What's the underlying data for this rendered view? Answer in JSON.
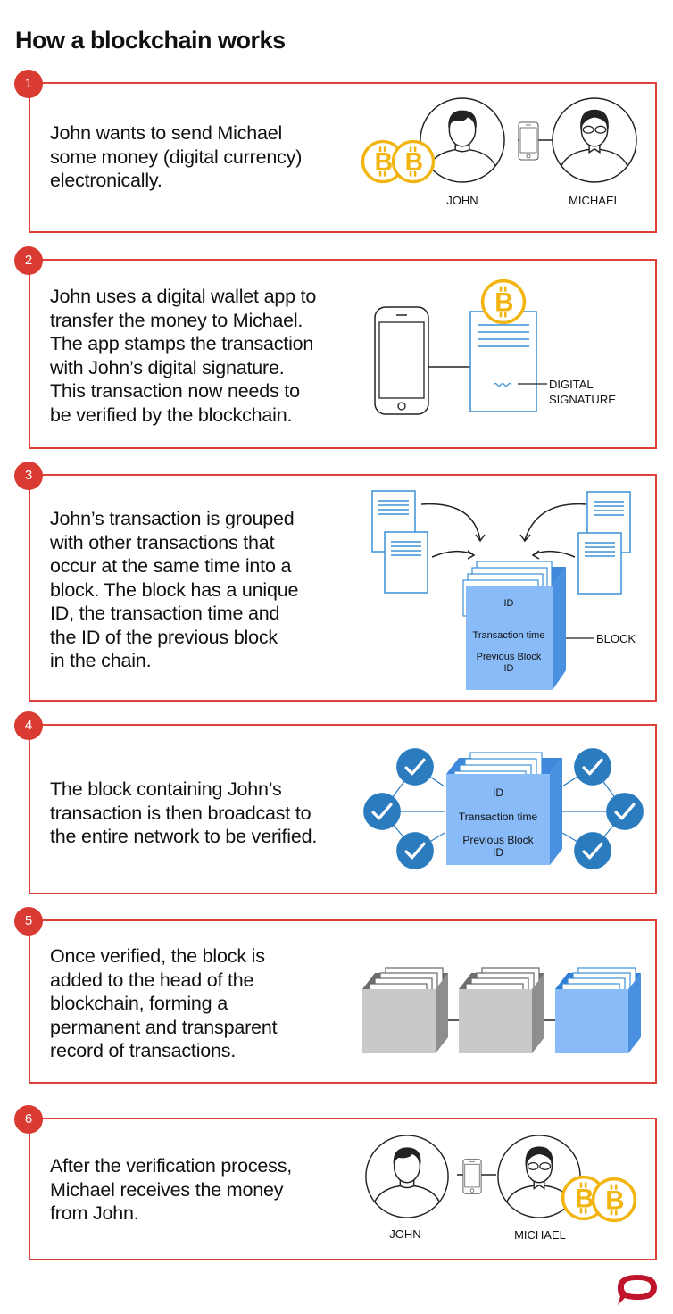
{
  "title": "How a blockchain works",
  "colors": {
    "accent_red": "#e0403a",
    "badge_red": "#d93a31",
    "coin_gold": "#f2b40f",
    "block_blue": "#88bbf7",
    "block_blue_dark": "#4a90e0",
    "node_blue": "#2b7bbf",
    "doc_blue": "#3b8fd6",
    "block_grey": "#c9c9c9",
    "logo_red": "#c0142a"
  },
  "steps": [
    {
      "number": "1",
      "lines": [
        "John wants to send Michael",
        "some money (digital currency)",
        "electronically."
      ],
      "labels": {
        "sender": "JOHN",
        "receiver": "MICHAEL"
      }
    },
    {
      "number": "2",
      "lines": [
        "John uses a digital wallet app to",
        "transfer the money to Michael.",
        "The app stamps the transaction",
        "with John’s digital signature.",
        "This transaction now needs to",
        "be verified by the blockchain."
      ],
      "labels": {
        "signature_line1": "DIGITAL",
        "signature_line2": "SIGNATURE"
      }
    },
    {
      "number": "3",
      "lines": [
        "John’s transaction is grouped",
        "with other transactions that",
        "occur at the same time into a",
        "block. The block has a unique",
        "ID, the transaction time and",
        "the ID of the previous block",
        "in the chain."
      ],
      "labels": {
        "block_id": "ID",
        "block_time": "Transaction time",
        "block_prev_1": "Previous Block",
        "block_prev_2": "ID",
        "block_callout": "BLOCK"
      }
    },
    {
      "number": "4",
      "lines": [
        "The block containing John’s",
        "transaction is then broadcast to",
        "the entire network to be verified."
      ],
      "labels": {
        "block_id": "ID",
        "block_time": "Transaction time",
        "block_prev_1": "Previous Block",
        "block_prev_2": "ID"
      }
    },
    {
      "number": "5",
      "lines": [
        "Once verified, the block is",
        "added to the head of the",
        "blockchain, forming a",
        "permanent and transparent",
        "record of transactions."
      ]
    },
    {
      "number": "6",
      "lines": [
        "After the verification process,",
        "Michael receives the money",
        "from John."
      ],
      "labels": {
        "sender": "JOHN",
        "receiver": "MICHAEL"
      }
    }
  ],
  "icons": {
    "coin": "bitcoin-coin",
    "phone": "smartphone",
    "person_john": "person-avatar",
    "person_michael": "person-with-glasses-avatar",
    "document": "transaction-document",
    "block": "open-box-block",
    "node": "check-circle-node",
    "logo": "speech-bubble-logo"
  }
}
